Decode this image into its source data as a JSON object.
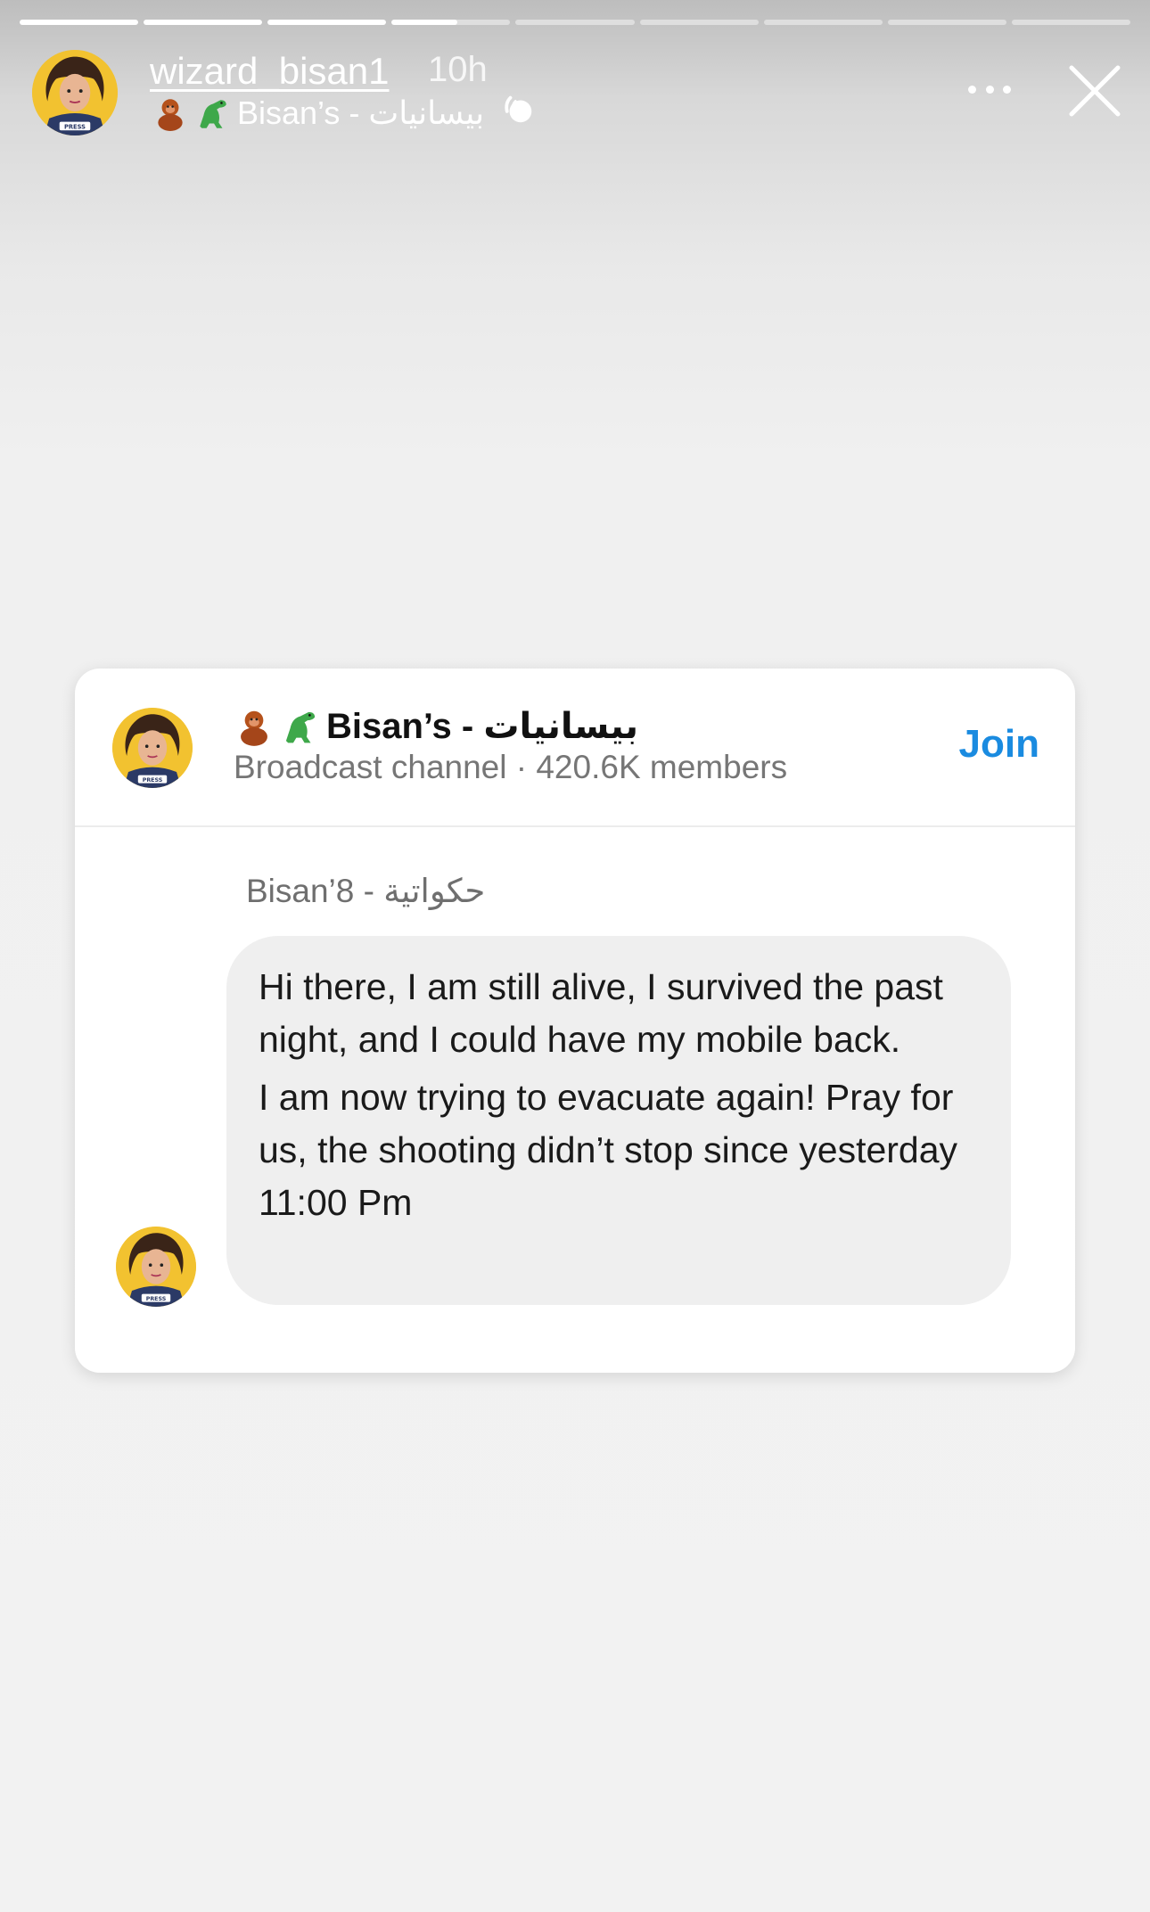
{
  "story": {
    "segments": [
      1,
      1,
      1,
      0.55,
      0,
      0,
      0,
      0,
      0
    ],
    "username": "wizard_bisan1",
    "time": "10h",
    "channel_label": "Bisan’s - بيسانيات",
    "icons": {
      "avatar": "avatar-press-icon",
      "emoji1": "orangutan-icon",
      "emoji2": "dinosaur-icon",
      "channel": "broadcast-channel-icon",
      "more": "more-icon",
      "close": "close-icon"
    }
  },
  "card": {
    "channel_name": "Bisan’s - بيسانيات",
    "channel_meta": "Broadcast channel · 420.6K members",
    "join_label": "Join",
    "sender": "Bisan’8 - حكواتية",
    "message": [
      "Hi there, I am still alive, I survived the past night, and I could have my mobile back.",
      "I am now trying to evacuate again! Pray for us, the shooting didn’t stop since yesterday 11:00 Pm"
    ]
  },
  "colors": {
    "accent": "#1a8be0",
    "avatar_bg": "#f2c230",
    "bubble_bg": "#efefef"
  }
}
